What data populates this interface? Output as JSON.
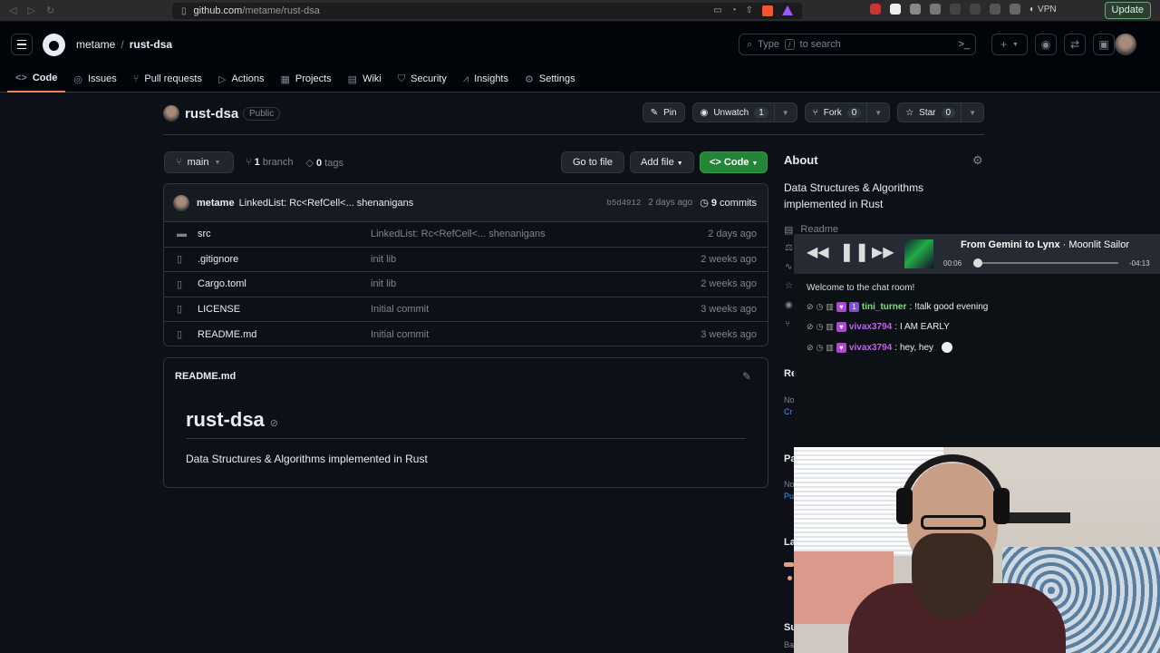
{
  "browser": {
    "url_host": "github.com",
    "url_path": "/metame/rust-dsa",
    "vpn_label": "VPN",
    "update_label": "Update"
  },
  "header": {
    "owner": "metame",
    "separator": "/",
    "repo": "rust-dsa",
    "search_prefix": "Type",
    "search_key": "/",
    "search_suffix": "to search",
    "new_label": "+"
  },
  "tabs": [
    {
      "label": "Code",
      "icon": "code-icon"
    },
    {
      "label": "Issues",
      "icon": "issue-icon"
    },
    {
      "label": "Pull requests",
      "icon": "pull-request-icon"
    },
    {
      "label": "Actions",
      "icon": "play-icon"
    },
    {
      "label": "Projects",
      "icon": "table-icon"
    },
    {
      "label": "Wiki",
      "icon": "book-icon"
    },
    {
      "label": "Security",
      "icon": "shield-icon"
    },
    {
      "label": "Insights",
      "icon": "graph-icon"
    },
    {
      "label": "Settings",
      "icon": "gear-icon"
    }
  ],
  "repo": {
    "name": "rust-dsa",
    "visibility": "Public",
    "pin_label": "Pin",
    "watch_label": "Unwatch",
    "watch_count": "1",
    "fork_label": "Fork",
    "fork_count": "0",
    "star_label": "Star",
    "star_count": "0"
  },
  "branch": {
    "current": "main",
    "branch_count": "1",
    "branch_label": "branch",
    "tag_count": "0",
    "tag_label": "tags",
    "goto_label": "Go to file",
    "addfile_label": "Add file",
    "code_label": "Code"
  },
  "latest_commit": {
    "author": "metame",
    "message": "LinkedList: Rc<RefCell<... shenanigans",
    "sha": "b5d4912",
    "time": "2 days ago",
    "commit_count": "9",
    "commit_label": "commits"
  },
  "files": [
    {
      "name": "src",
      "type": "folder",
      "commit": "LinkedList: Rc<RefCell<... shenanigans",
      "date": "2 days ago"
    },
    {
      "name": ".gitignore",
      "type": "file",
      "commit": "init lib",
      "date": "2 weeks ago"
    },
    {
      "name": "Cargo.toml",
      "type": "file",
      "commit": "init lib",
      "date": "2 weeks ago"
    },
    {
      "name": "LICENSE",
      "type": "file",
      "commit": "Initial commit",
      "date": "3 weeks ago"
    },
    {
      "name": "README.md",
      "type": "file",
      "commit": "Initial commit",
      "date": "3 weeks ago"
    }
  ],
  "readme": {
    "filename": "README.md",
    "title": "rust-dsa",
    "description": "Data Structures & Algorithms implemented in Rust"
  },
  "about": {
    "title": "About",
    "description": "Data Structures & Algorithms implemented in Rust",
    "readme_link": "Readme",
    "partials": {
      "re": "Re",
      "no1": "No",
      "cr": "Cr",
      "pa": "Pa",
      "no2": "No",
      "pu": "Pu",
      "la": "La",
      "su": "Su",
      "ba": "Ba"
    }
  },
  "player": {
    "track_title": "From Gemini to Lynx",
    "artist": "Moonlit Sailor",
    "elapsed": "00:06",
    "remaining": "-04:13",
    "progress": 0.02
  },
  "chat": {
    "welcome": "Welcome to the chat room!",
    "messages": [
      {
        "user": "tini_turner",
        "text": "!talk good evening",
        "color": "#7ee07e"
      },
      {
        "user": "vivax3794",
        "text": "I AM EARLY",
        "color": "#c55ff0"
      },
      {
        "user": "vivax3794",
        "text": "hey, hey",
        "color": "#c55ff0"
      }
    ]
  },
  "colors": {
    "accent_tab": "#f78166",
    "code_button": "#238636",
    "link": "#4493f8"
  }
}
